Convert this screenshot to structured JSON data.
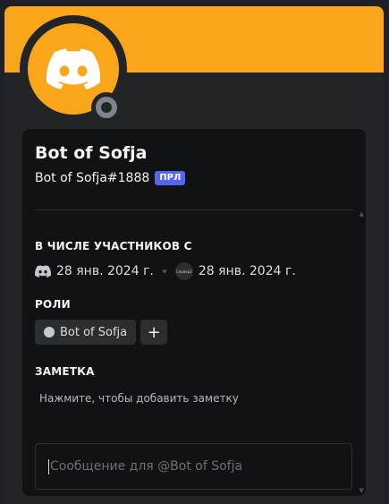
{
  "profile": {
    "display_name": "Bot of Sofja",
    "username": "Bot of Sofja#1888",
    "bot_badge": "ПРЛ",
    "banner_color": "#faa61a",
    "avatar_color": "#faa61a",
    "avatar_icon": "discord-logo-icon",
    "status": "offline"
  },
  "member_since": {
    "title": "В ЧИСЛЕ УЧАСТНИКОВ С",
    "discord_date": "28 янв. 2024 г.",
    "server_icon_text": "Сервер3",
    "server_date": "28 янв. 2024 г."
  },
  "roles": {
    "title": "РОЛИ",
    "items": [
      {
        "label": "Bot of Sofja",
        "color": "#c4c9ce"
      }
    ],
    "add_label": "+"
  },
  "note": {
    "title": "ЗАМЕТКА",
    "placeholder": "Нажмите, чтобы добавить заметку"
  },
  "message": {
    "placeholder": "Сообщение для @Bot of Sofja"
  }
}
